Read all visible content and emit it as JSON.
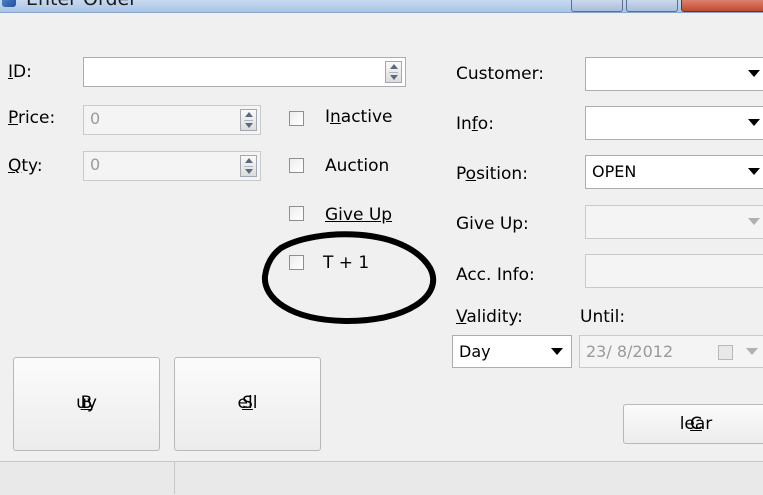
{
  "window": {
    "title": "Enter Order"
  },
  "labels": {
    "id": "ID:",
    "price": "Price:",
    "qty": "Qty:",
    "customer": "Customer:",
    "info": "Info:",
    "position": "Position:",
    "give_up": "Give Up:",
    "acc_info": "Acc. Info:",
    "validity": "Validity:",
    "until": "Until:"
  },
  "fields": {
    "id_value": "",
    "price_value": "0",
    "qty_value": "0",
    "customer_value": "",
    "info_value": "",
    "position_value": "OPEN",
    "give_up_value": "",
    "acc_info_value": "",
    "validity_value": "Day",
    "until_value": "23/ 8/2012"
  },
  "checkboxes": {
    "inactive": "Inactive",
    "auction": "Auction",
    "give_up": "Give Up",
    "t_plus_1": "T + 1"
  },
  "buttons": {
    "buy": "Buy",
    "sell": "Sell",
    "clear": "Clear"
  },
  "annotation": {
    "color": "#000000"
  },
  "icons": [
    "window-app-icon",
    "spin-icon",
    "dropdown-arrow-icon",
    "calendar-icon"
  ]
}
